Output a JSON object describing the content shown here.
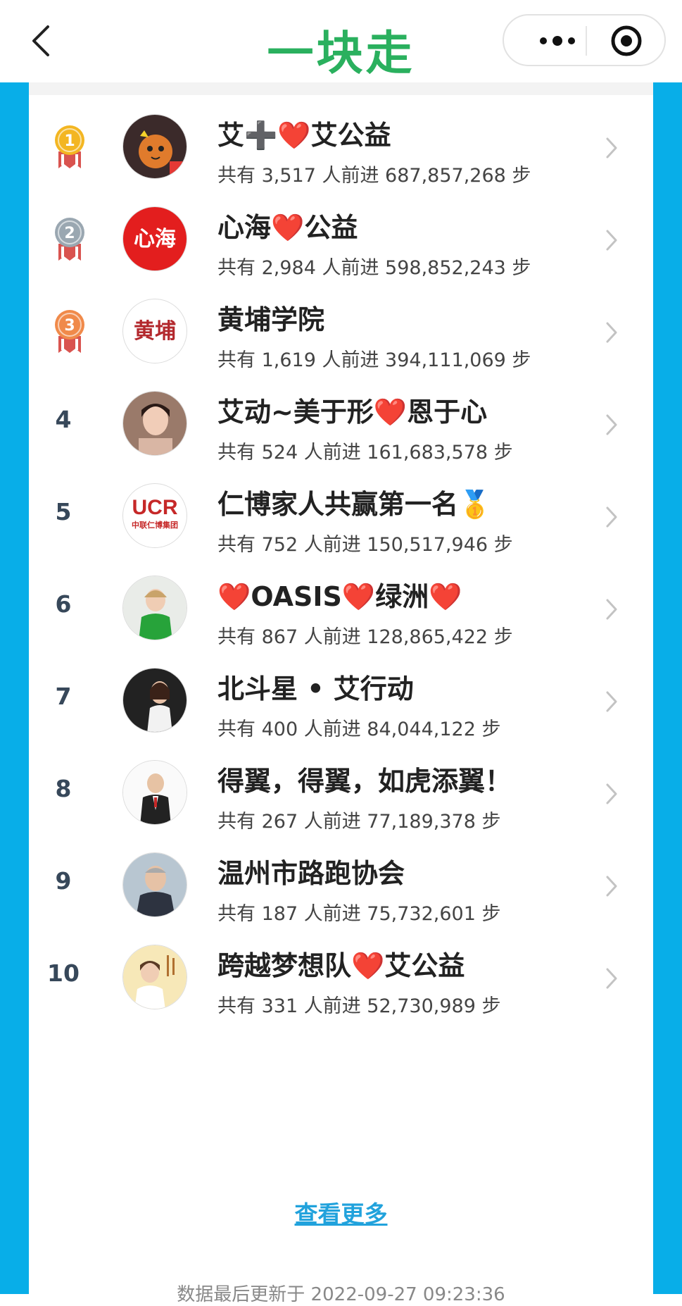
{
  "header": {
    "title": "一块走",
    "title_color": "#2ab05e"
  },
  "colors": {
    "frame": "#08aee8",
    "link": "#21a2dc",
    "heart": "#e02424",
    "gold": "#f3b622",
    "silver": "#9aa7b1",
    "bronze": "#f08a4a"
  },
  "rankings": [
    {
      "rank": "1",
      "medal": "gold",
      "name": "艾➕❤️艾公益",
      "stats": "共有 3,517 人前进 687,857,268 步",
      "avatar": "avatar-cartoon"
    },
    {
      "rank": "2",
      "medal": "silver",
      "name": "心海❤️公益",
      "stats": "共有 2,984 人前进 598,852,243 步",
      "avatar": "avatar-xinhai-logo",
      "avatar_text": "心海"
    },
    {
      "rank": "3",
      "medal": "bronze",
      "name": "黄埔学院",
      "stats": "共有 1,619 人前进 394,111,069 步",
      "avatar": "avatar-huangpu-logo",
      "avatar_text": "黄埔"
    },
    {
      "rank": "4",
      "medal": "",
      "name": "艾动~美于形❤️恩于心",
      "stats": "共有 524 人前进 161,683,578 步",
      "avatar": "avatar-photo-woman"
    },
    {
      "rank": "5",
      "medal": "",
      "name": "仁博家人共赢第一名🥇",
      "stats": "共有 752 人前进 150,517,946 步",
      "avatar": "avatar-ucr-logo",
      "avatar_text": "UCR",
      "avatar_subtext": "中联仁博集团"
    },
    {
      "rank": "6",
      "medal": "",
      "name": "❤️OASIS❤️绿洲❤️",
      "stats": "共有 867 人前进 128,865,422 步",
      "avatar": "avatar-photo-woman-green"
    },
    {
      "rank": "7",
      "medal": "",
      "name": "北斗星 • 艾行动",
      "stats": "共有 400 人前进 84,044,122 步",
      "avatar": "avatar-photo-woman-dark"
    },
    {
      "rank": "8",
      "medal": "",
      "name": "得翼，得翼，如虎添翼！",
      "stats": "共有 267 人前进 77,189,378 步",
      "avatar": "avatar-photo-man-suit"
    },
    {
      "rank": "9",
      "medal": "",
      "name": "温州市路跑协会",
      "stats": "共有 187 人前进 75,732,601 步",
      "avatar": "avatar-photo-man"
    },
    {
      "rank": "10",
      "medal": "",
      "name": "跨越梦想队❤️艾公益",
      "stats": "共有 331 人前进 52,730,989 步",
      "avatar": "avatar-photo-woman-poster"
    }
  ],
  "footer": {
    "view_more": "查看更多",
    "updated": "数据最后更新于 2022-09-27 09:23:36"
  }
}
